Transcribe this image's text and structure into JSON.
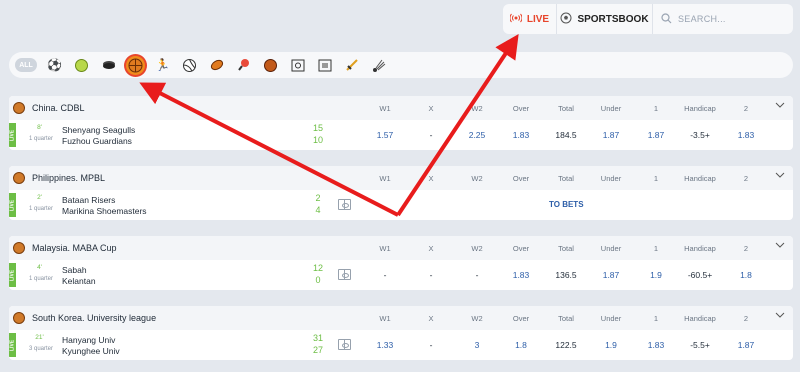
{
  "nav": {
    "live_label": "LIVE",
    "sportsbook_label": "SPORTSBOOK",
    "search_placeholder": "SEARCH..."
  },
  "sport_filter": {
    "all_label": "ALL",
    "icons": [
      "soccer-icon",
      "tennis-icon",
      "hockey-icon",
      "basketball-icon",
      "running-icon",
      "volleyball-icon",
      "american-football-icon",
      "table-tennis-icon",
      "handball-icon",
      "futsal-icon",
      "field-icon",
      "sword-icon",
      "badminton-icon"
    ],
    "active_icon": "basketball-icon"
  },
  "columns": [
    "W1",
    "X",
    "W2",
    "Over",
    "Total",
    "Under",
    "1",
    "Handicap",
    "2"
  ],
  "events": [
    {
      "league": "China. CDBL",
      "minute": "8'",
      "period": "1 quarter",
      "team1": "Shenyang Seagulls",
      "team2": "Fuzhou Guardians",
      "score1": "15",
      "score2": "10",
      "odds": [
        "1.57",
        "-",
        "2.25",
        "1.83",
        "184.5",
        "1.87",
        "1.87",
        "-3.5+",
        "1.83"
      ]
    },
    {
      "league": "Philippines. MPBL",
      "minute": "2'",
      "period": "1 quarter",
      "team1": "Bataan Risers",
      "team2": "Marikina Shoemasters",
      "score1": "2",
      "score2": "4",
      "to_bets": "TO BETS"
    },
    {
      "league": "Malaysia. MABA Cup",
      "minute": "4'",
      "period": "1 quarter",
      "team1": "Sabah",
      "team2": "Kelantan",
      "score1": "12",
      "score2": "0",
      "odds": [
        "-",
        "-",
        "-",
        "1.83",
        "136.5",
        "1.87",
        "1.9",
        "-60.5+",
        "1.8"
      ]
    },
    {
      "league": "South Korea. University league",
      "minute": "21'",
      "period": "3 quarter",
      "team1": "Hanyang Univ",
      "team2": "Kyunghee Univ",
      "score1": "31",
      "score2": "27",
      "odds": [
        "1.33",
        "-",
        "3",
        "1.8",
        "122.5",
        "1.9",
        "1.83",
        "-5.5+",
        "1.87"
      ]
    }
  ],
  "live_badge": "LIVE",
  "colors": {
    "accent": "#e8452c",
    "live_green": "#6dbe45",
    "odd_blue": "#2d5ea8"
  }
}
